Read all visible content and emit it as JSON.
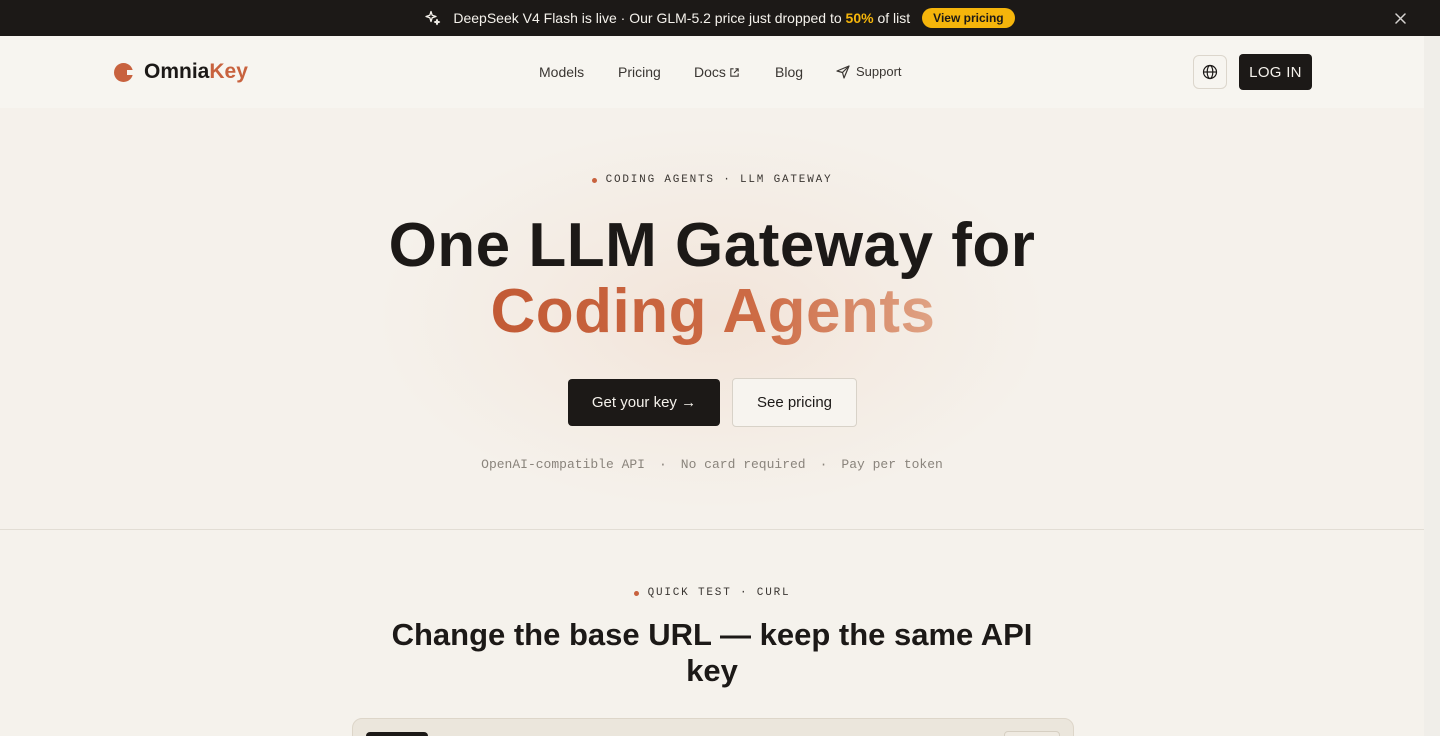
{
  "announcement": {
    "prefix": "DeepSeek V4 Flash is live · Our GLM-5.2 price just dropped to ",
    "highlight": "50%",
    "suffix": " of list",
    "cta": "View pricing",
    "highlight_color": "#f5b50b"
  },
  "brand": {
    "name_part1": "Omnia",
    "name_part2": "Key",
    "accent_color": "#c8623e"
  },
  "nav": {
    "models": "Models",
    "pricing": "Pricing",
    "docs": "Docs",
    "blog": "Blog",
    "support": "Support",
    "login": "LOG IN"
  },
  "hero": {
    "eyebrow": "CODING AGENTS · LLM GATEWAY",
    "title_line1": "One LLM Gateway for",
    "title_line2": "Coding Agents",
    "primary_cta": "Get your key →",
    "secondary_cta": "See pricing",
    "features": [
      "OpenAI-compatible API",
      "No card required",
      "Pay per token"
    ],
    "feature_separator": "·"
  },
  "quick_test": {
    "eyebrow": "QUICK TEST · CURL",
    "title": "Change the base URL — keep the same API key"
  },
  "icons": {
    "announcement": "sparkle-icon",
    "close": "close-icon",
    "docs_external": "external-link-icon",
    "support": "send-icon",
    "language": "globe-icon"
  }
}
